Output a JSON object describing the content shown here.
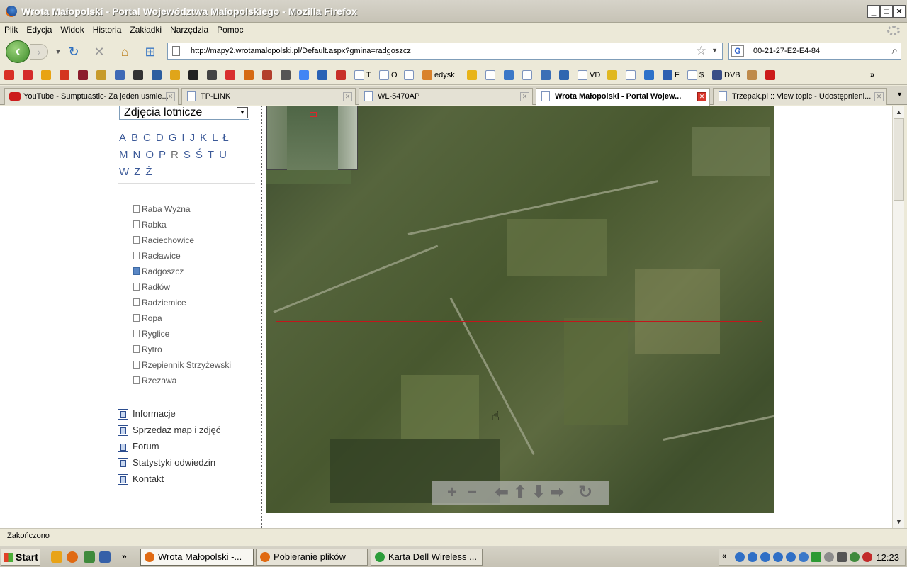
{
  "window": {
    "title": "Wrota Małopolski - Portal Województwa Małopolskiego - Mozilla Firefox"
  },
  "menu": [
    "Plik",
    "Edycja",
    "Widok",
    "Historia",
    "Zakładki",
    "Narzędzia",
    "Pomoc"
  ],
  "nav": {
    "url": "http://mapy2.wrotamalopolski.pl/Default.aspx?gmina=radgoszcz",
    "search_value": "00-21-27-E2-E4-84"
  },
  "bookmarks": {
    "items": [
      {
        "label": "",
        "icon": "gmail-icon",
        "color": "#d93025"
      },
      {
        "label": "",
        "icon": "red-flower-icon",
        "color": "#d42a2a"
      },
      {
        "label": "",
        "icon": "int-icon",
        "color": "#e8a312"
      },
      {
        "label": "",
        "icon": "bars-icon",
        "color": "#d4361f"
      },
      {
        "label": "",
        "icon": "helmet-icon",
        "color": "#8b1c2c"
      },
      {
        "label": "",
        "icon": "m-icon",
        "color": "#c79b2b"
      },
      {
        "label": "",
        "icon": "circle-icon",
        "color": "#3f6ab6"
      },
      {
        "label": "",
        "icon": "sun-icon",
        "color": "#333333"
      },
      {
        "label": "",
        "icon": "pi-icon",
        "color": "#2c5ea0"
      },
      {
        "label": "",
        "icon": "crown-icon",
        "color": "#e0a51a"
      },
      {
        "label": "",
        "icon": "camera-icon",
        "color": "#222222"
      },
      {
        "label": "",
        "icon": "ball-icon",
        "color": "#444444"
      },
      {
        "label": "",
        "icon": "flower-icon",
        "color": "#d92f2f"
      },
      {
        "label": "",
        "icon": "fox-icon",
        "color": "#d66a12"
      },
      {
        "label": "",
        "icon": "bag-icon",
        "color": "#b3402c"
      },
      {
        "label": "",
        "icon": "key-icon",
        "color": "#555555"
      },
      {
        "label": "",
        "icon": "google-icon",
        "color": "#4285f4"
      },
      {
        "label": "",
        "icon": "z-icon",
        "color": "#2a62b5"
      },
      {
        "label": "",
        "icon": "c-icon",
        "color": "#c8302a"
      },
      {
        "label": "T",
        "icon": "page-icon",
        "color": "#ffffff"
      },
      {
        "label": "O",
        "icon": "page-icon",
        "color": "#ffffff"
      },
      {
        "label": "",
        "icon": "page-icon",
        "color": "#ffffff"
      },
      {
        "label": "edysk",
        "icon": "runner-icon",
        "color": "#d9822b"
      },
      {
        "label": "",
        "icon": "m-circle-icon",
        "color": "#e8b418"
      },
      {
        "label": "",
        "icon": "page-icon",
        "color": "#ffffff"
      },
      {
        "label": "",
        "icon": "mail-icon",
        "color": "#3b78c7"
      },
      {
        "label": "",
        "icon": "page-icon",
        "color": "#ffffff"
      },
      {
        "label": "",
        "icon": "plane-icon",
        "color": "#3b6fb6"
      },
      {
        "label": "",
        "icon": "globe-icon",
        "color": "#2f66b0"
      },
      {
        "label": "VD",
        "icon": "page-icon",
        "color": "#ffffff"
      },
      {
        "label": "",
        "icon": "arrow-icon",
        "color": "#e0b820"
      },
      {
        "label": "",
        "icon": "page-icon",
        "color": "#ffffff"
      },
      {
        "label": "",
        "icon": "k-icon",
        "color": "#2e72c9"
      },
      {
        "label": "F",
        "icon": "f-icon",
        "color": "#2d5fb0"
      },
      {
        "label": "$",
        "icon": "page-icon",
        "color": "#ffffff"
      },
      {
        "label": "DVB",
        "icon": "b-icon",
        "color": "#3a4e86"
      },
      {
        "label": "",
        "icon": "hand-icon",
        "color": "#bf8a4a"
      },
      {
        "label": "",
        "icon": "youtube-icon",
        "color": "#cc1b1b"
      }
    ],
    "overflow": "»"
  },
  "tabs": [
    {
      "label": "YouTube - Sumptuastic- Za jeden usmie...",
      "icon": "youtube-icon",
      "active": false
    },
    {
      "label": "TP-LINK",
      "icon": "page-icon",
      "active": false
    },
    {
      "label": "WL-5470AP",
      "icon": "page-icon",
      "active": false
    },
    {
      "label": "Wrota Małopolski - Portal Wojew...",
      "icon": "page-icon",
      "active": true
    },
    {
      "label": "Trzepak.pl :: View topic - Udostępnieni...",
      "icon": "page-icon",
      "active": false
    }
  ],
  "sidebar": {
    "map_type": "Zdjęcia lotnicze",
    "alphabet_rows": [
      [
        {
          "l": "A",
          "link": true
        },
        {
          "l": "B",
          "link": true
        },
        {
          "l": "C",
          "link": true
        },
        {
          "l": "D",
          "link": true
        },
        {
          "l": "G",
          "link": true
        },
        {
          "l": "I",
          "link": true
        },
        {
          "l": "J",
          "link": true
        },
        {
          "l": "K",
          "link": true
        },
        {
          "l": "L",
          "link": true
        },
        {
          "l": "Ł",
          "link": true
        }
      ],
      [
        {
          "l": "M",
          "link": true
        },
        {
          "l": "N",
          "link": true
        },
        {
          "l": "O",
          "link": true
        },
        {
          "l": "P",
          "link": true
        },
        {
          "l": "R",
          "link": false
        },
        {
          "l": "S",
          "link": true
        },
        {
          "l": "Ś",
          "link": true
        },
        {
          "l": "T",
          "link": true
        },
        {
          "l": "U",
          "link": true
        }
      ],
      [
        {
          "l": "W",
          "link": true
        },
        {
          "l": "Z",
          "link": true
        },
        {
          "l": "Ż",
          "link": true
        }
      ]
    ],
    "gminy": [
      {
        "name": "Raba Wyżna",
        "selected": false
      },
      {
        "name": "Rabka",
        "selected": false
      },
      {
        "name": "Raciechowice",
        "selected": false
      },
      {
        "name": "Racławice",
        "selected": false
      },
      {
        "name": "Radgoszcz",
        "selected": true
      },
      {
        "name": "Radłów",
        "selected": false
      },
      {
        "name": "Radziemice",
        "selected": false
      },
      {
        "name": "Ropa",
        "selected": false
      },
      {
        "name": "Ryglice",
        "selected": false
      },
      {
        "name": "Rytro",
        "selected": false
      },
      {
        "name": "Rzepiennik Strzyżewski",
        "selected": false
      },
      {
        "name": "Rzezawa",
        "selected": false
      }
    ],
    "links": [
      "Informacje",
      "Sprzedaż map i zdjęć",
      "Forum",
      "Statystyki odwiedzin",
      "Kontakt"
    ]
  },
  "map": {
    "controls": {
      "zoom_in": "+",
      "zoom_out": "−",
      "pan_left": "⬅",
      "pan_up": "⬆",
      "pan_down": "⬇",
      "pan_right": "➡",
      "reset": "↻"
    }
  },
  "status": {
    "text": "Zakończono"
  },
  "taskbar": {
    "start": "Start",
    "tasks": [
      {
        "label": "Wrota Małopolski -...",
        "active": true,
        "color": "#e06a12"
      },
      {
        "label": "Pobieranie plików",
        "active": false,
        "color": "#e06a12"
      },
      {
        "label": "Karta Dell Wireless ...",
        "active": false,
        "color": "#2c9d3a"
      }
    ],
    "clock": "12:23"
  }
}
